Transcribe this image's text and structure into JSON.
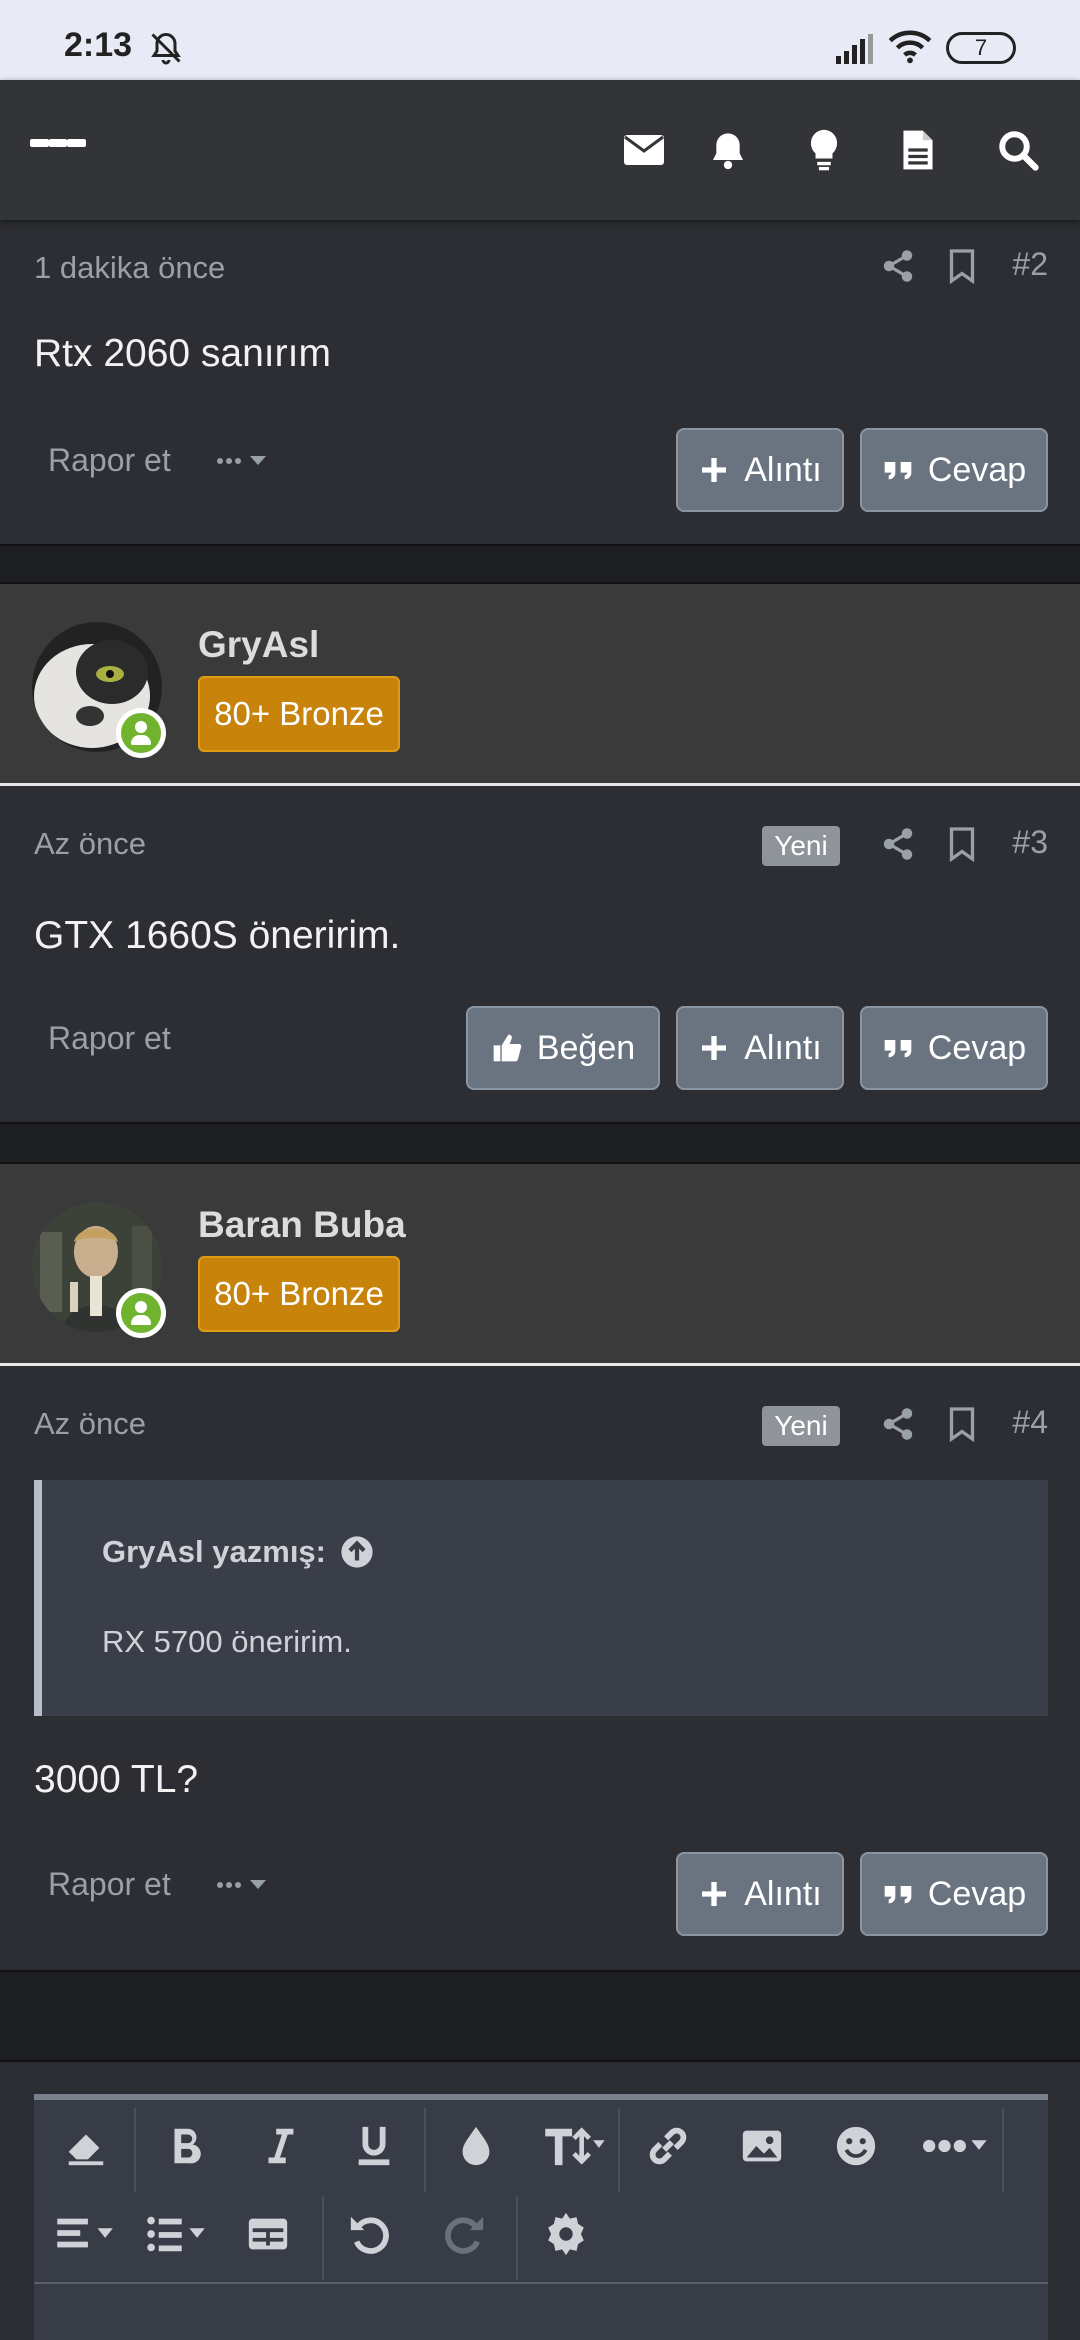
{
  "status_bar": {
    "time": "2:13",
    "battery": "7"
  },
  "app_bar": {
    "icons": [
      "menu-icon",
      "avatar",
      "envelope-icon",
      "bell-icon",
      "lightbulb-icon",
      "document-icon",
      "search-icon"
    ]
  },
  "posts": [
    {
      "time": "1 dakika önce",
      "number": "#2",
      "content": "Rtx 2060 sanırım",
      "report": "Rapor et",
      "buttons": {
        "quote": "Alıntı",
        "reply": "Cevap"
      }
    },
    {
      "user": "GryAsl",
      "rank": "80+ Bronze",
      "time": "Az önce",
      "new_badge": "Yeni",
      "number": "#3",
      "content": "GTX 1660S öneririm.",
      "report": "Rapor et",
      "buttons": {
        "like": "Beğen",
        "quote": "Alıntı",
        "reply": "Cevap"
      }
    },
    {
      "user": "Baran Buba",
      "rank": "80+ Bronze",
      "time": "Az önce",
      "new_badge": "Yeni",
      "number": "#4",
      "quote": {
        "header": "GryAsl yazmış:",
        "text": "RX 5700 öneririm."
      },
      "content": "3000 TL?",
      "report": "Rapor et",
      "buttons": {
        "quote": "Alıntı",
        "reply": "Cevap"
      }
    }
  ],
  "editor_toolbar": {
    "row1": [
      "eraser-icon",
      "bold-icon",
      "italic-icon",
      "underline-icon",
      "color-drop-icon",
      "text-size-icon",
      "link-icon",
      "image-icon",
      "smiley-icon",
      "more-icon"
    ],
    "row2": [
      "align-icon",
      "list-icon",
      "table-icon",
      "undo-icon",
      "redo-icon",
      "gear-icon"
    ]
  },
  "colors": {
    "badge": "#c8830b",
    "online": "#6fb32e",
    "button": "#6a7380"
  }
}
